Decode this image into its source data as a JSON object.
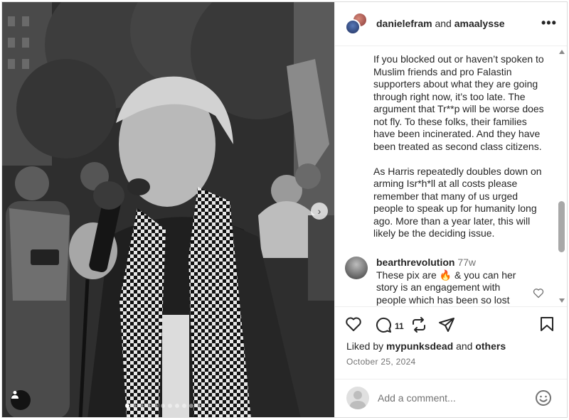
{
  "header": {
    "user1": "danielefram",
    "joiner": "and",
    "user2": "amaalysse",
    "more_label": "•••"
  },
  "caption": {
    "paragraphs": [
      "If you blocked out or haven’t spoken to Muslim friends and pro Falastin supporters about what they are going through right now, it’s too late. The argument that Tr**p will be worse does not fly. To these folks, their families have been incinerated. And they have been treated as second class citizens.",
      "As Harris repeatedly doubles down on arming Isr*h*ll at all costs please remember that many of us urged people to speak up for humanity long ago. More than a year later, this will likely be the deciding issue."
    ]
  },
  "comment": {
    "user": "bearthrevolution",
    "time": "77w",
    "text_before": "These pix are ",
    "emoji": "🔥",
    "text_after": " & you can her story is an engagement with people which has been so lost in"
  },
  "actions": {
    "comment_count": "11"
  },
  "likes": {
    "prefix": "Liked by",
    "user": "mypunksdead",
    "joiner": "and",
    "others": "others"
  },
  "date": "October 25, 2024",
  "add_comment": {
    "placeholder": "Add a comment..."
  },
  "carousel": {
    "total": 11,
    "active": 0
  },
  "icons": {
    "heart": "heart-icon",
    "comment": "comment-icon",
    "repost": "repost-icon",
    "share": "share-icon",
    "bookmark": "bookmark-icon",
    "emoji": "emoji-icon",
    "user_tag": "user-tag-icon",
    "next": "chevron-right-icon",
    "more": "more-icon"
  }
}
